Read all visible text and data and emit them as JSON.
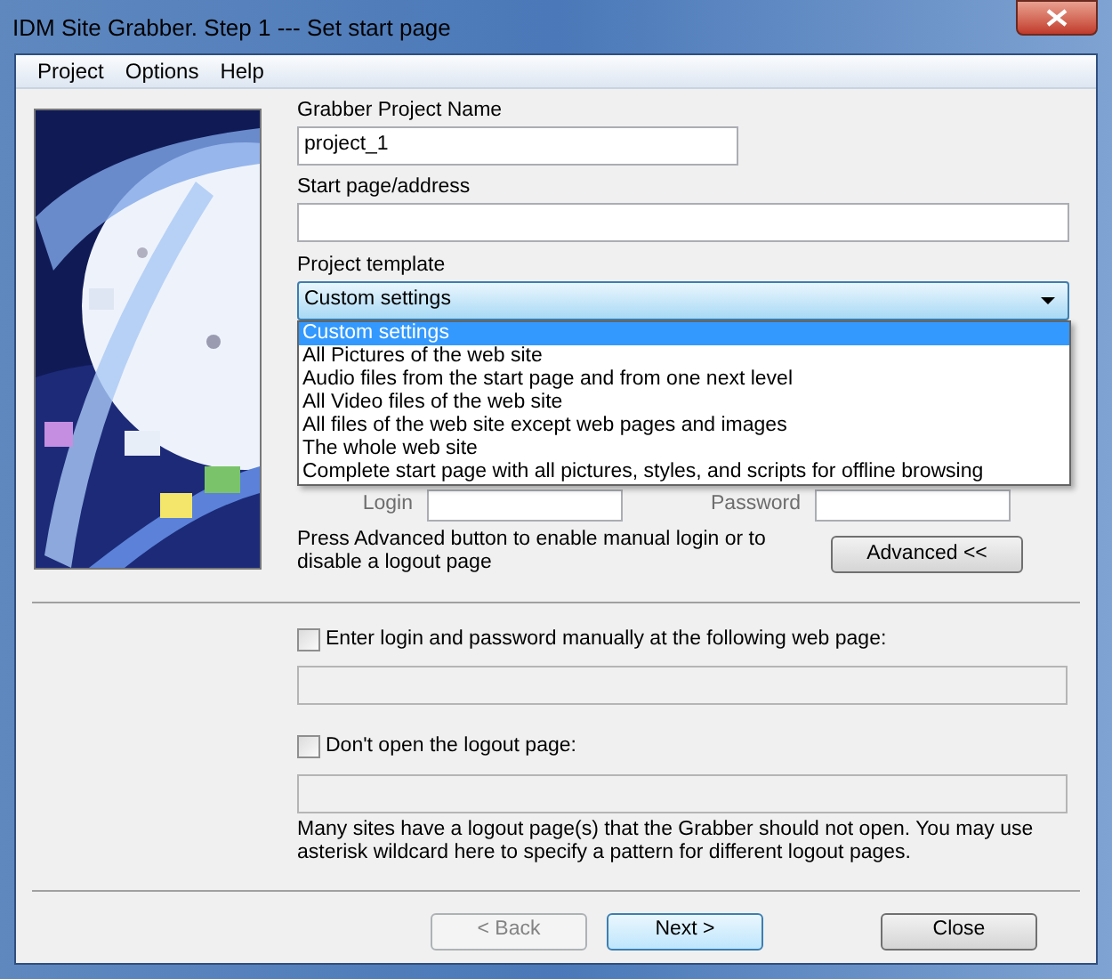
{
  "window": {
    "title": "IDM Site Grabber. Step 1 --- Set start page"
  },
  "menu": [
    {
      "label": "Project"
    },
    {
      "label": "Options"
    },
    {
      "label": "Help"
    }
  ],
  "project_name": {
    "label": "Grabber Project Name",
    "value": "project_1"
  },
  "start_page": {
    "label": "Start page/address"
  },
  "template": {
    "label": "Project template",
    "value": "Custom settings",
    "expanded": true,
    "options": [
      {
        "label": "Custom settings",
        "selected": true
      },
      {
        "label": "All Pictures of the web site",
        "selected": false
      },
      {
        "label": "Audio files from the start page and from one next level",
        "selected": false
      },
      {
        "label": "All Video files of the web site",
        "selected": false
      },
      {
        "label": "All files of the web site except web pages and images",
        "selected": false
      },
      {
        "label": "The whole web site",
        "selected": false
      },
      {
        "label": "Complete start page with all pictures, styles, and scripts for offline browsing",
        "selected": false
      }
    ]
  },
  "login": {
    "label": "Login"
  },
  "password": {
    "label": "Password"
  },
  "advanced": {
    "text": "Press Advanced button to enable manual login or to disable a logout page",
    "button": "Advanced <<"
  },
  "manual_login": {
    "label": "Enter login and password manually at the following web page:",
    "checked": false
  },
  "logout": {
    "label": "Don't open the logout page:",
    "checked": false
  },
  "logout_help": "Many sites have a logout page(s) that the Grabber should not open.  You may use asterisk wildcard here to specify a pattern for different logout pages.",
  "buttons": [
    {
      "label": "< Back",
      "disabled": true,
      "default": false
    },
    {
      "label": "Next >",
      "disabled": false,
      "default": true
    },
    {
      "label": "Close",
      "disabled": false,
      "default": false
    }
  ]
}
